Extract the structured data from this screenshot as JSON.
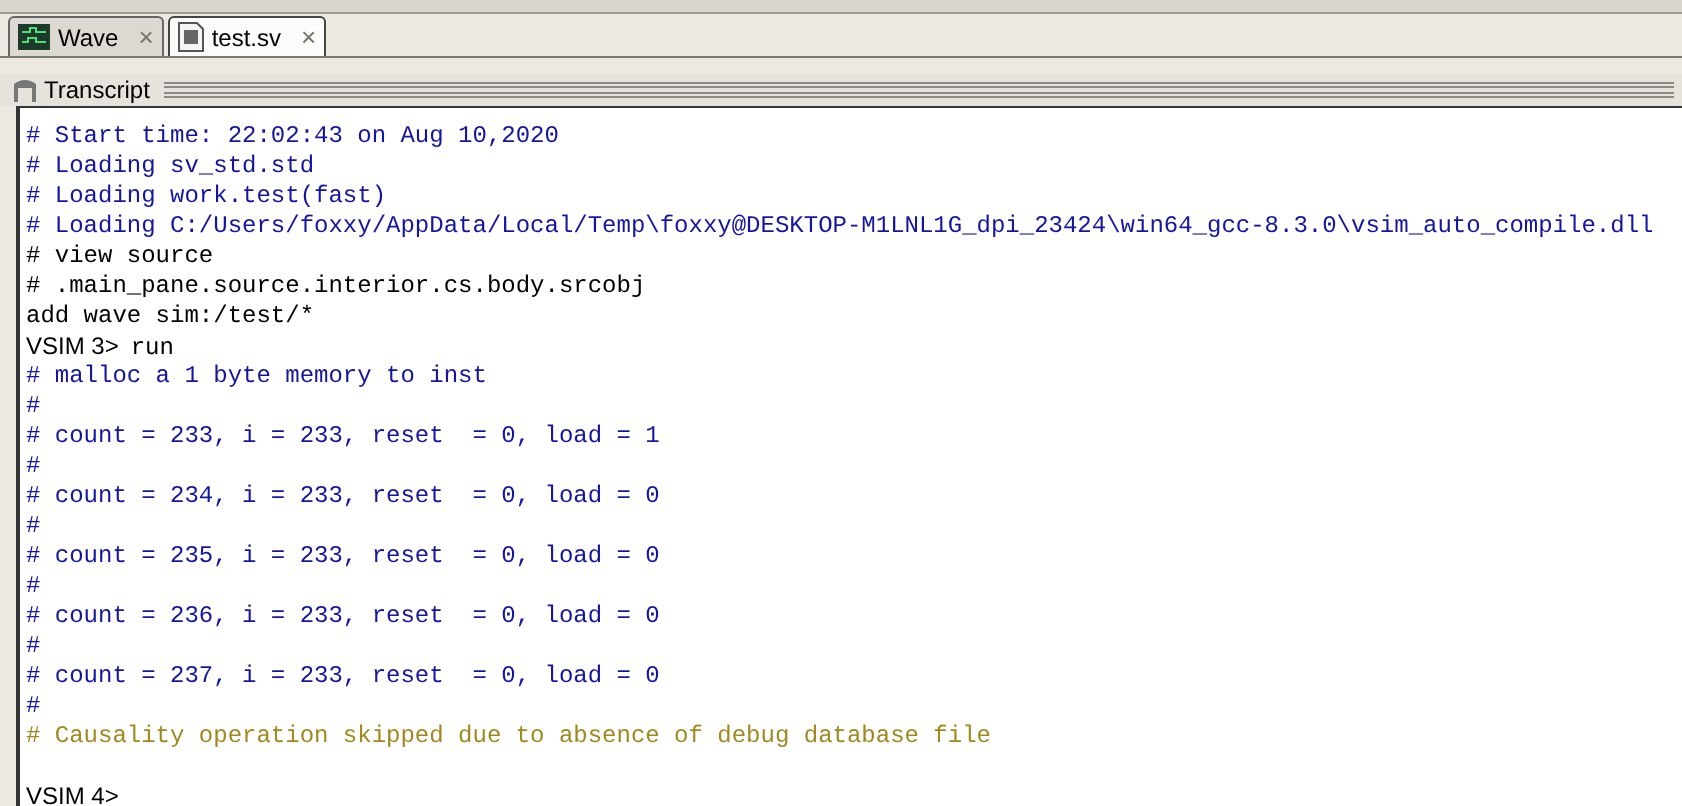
{
  "tabs": [
    {
      "label": "Wave",
      "close": "×",
      "selected": false
    },
    {
      "label": "test.sv",
      "close": "×",
      "selected": true
    }
  ],
  "pane": {
    "title": "Transcript"
  },
  "lines": [
    {
      "kind": "comment",
      "text": "# Start time: 22:02:43 on Aug 10,2020"
    },
    {
      "kind": "comment",
      "text": "# Loading sv_std.std"
    },
    {
      "kind": "comment",
      "text": "# Loading work.test(fast)"
    },
    {
      "kind": "comment",
      "text": "# Loading C:/Users/foxxy/AppData/Local/Temp\\foxxy@DESKTOP-M1LNL1G_dpi_23424\\win64_gcc-8.3.0\\vsim_auto_compile.dll"
    },
    {
      "kind": "command",
      "text": "# view source"
    },
    {
      "kind": "command",
      "text": "# .main_pane.source.interior.cs.body.srcobj"
    },
    {
      "kind": "command",
      "text": "add wave sim:/test/*"
    },
    {
      "kind": "prompt",
      "prompt": "VSIM 3>",
      "text": "run"
    },
    {
      "kind": "comment",
      "text": "# malloc a 1 byte memory to inst"
    },
    {
      "kind": "comment",
      "text": "#"
    },
    {
      "kind": "comment",
      "text": "# count = 233, i = 233, reset  = 0, load = 1"
    },
    {
      "kind": "comment",
      "text": "#"
    },
    {
      "kind": "comment",
      "text": "# count = 234, i = 233, reset  = 0, load = 0"
    },
    {
      "kind": "comment",
      "text": "#"
    },
    {
      "kind": "comment",
      "text": "# count = 235, i = 233, reset  = 0, load = 0"
    },
    {
      "kind": "comment",
      "text": "#"
    },
    {
      "kind": "comment",
      "text": "# count = 236, i = 233, reset  = 0, load = 0"
    },
    {
      "kind": "comment",
      "text": "#"
    },
    {
      "kind": "comment",
      "text": "# count = 237, i = 233, reset  = 0, load = 0"
    },
    {
      "kind": "comment",
      "text": "#"
    },
    {
      "kind": "warning",
      "text": "# Causality operation skipped due to absence of debug database file"
    },
    {
      "kind": "blank"
    },
    {
      "kind": "prompt",
      "prompt": "VSIM 4>"
    }
  ]
}
